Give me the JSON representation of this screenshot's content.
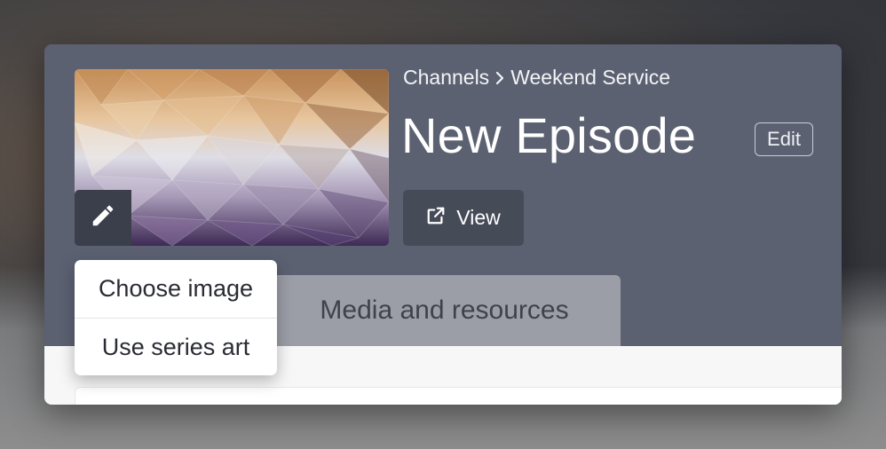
{
  "breadcrumb": {
    "parent": "Channels",
    "current": "Weekend Service"
  },
  "episode": {
    "title": "New Episode",
    "edit_label": "Edit",
    "view_label": "View"
  },
  "tabs": [
    {
      "label": "Media and resources"
    }
  ],
  "art_menu": {
    "items": [
      {
        "label": "Choose image"
      },
      {
        "label": "Use series art"
      }
    ]
  },
  "icons": {
    "edit_art": "pencil-icon",
    "view": "external-link-icon",
    "breadcrumb_separator": "chevron-right-icon"
  },
  "colors": {
    "header_bg": "#5c6172",
    "button_dark": "#464b58",
    "tab_bg": "#9b9ea7",
    "menu_bg": "#ffffff"
  }
}
